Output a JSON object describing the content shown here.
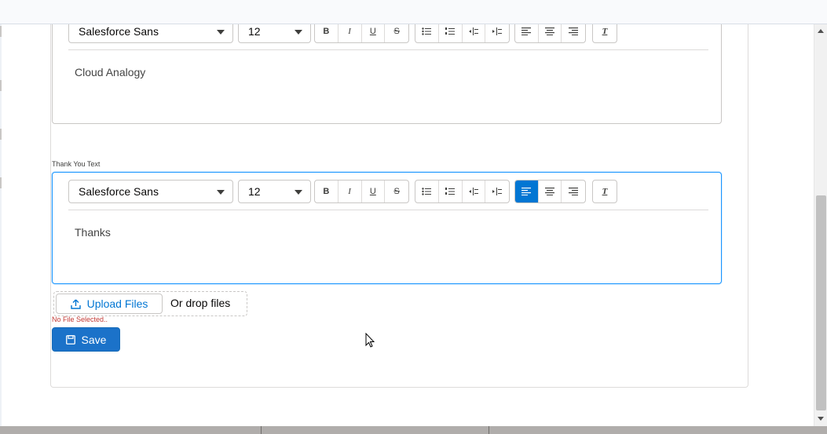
{
  "editors": [
    {
      "font_family": "Salesforce Sans",
      "font_size": "12",
      "content": "Cloud Analogy",
      "active_alignment": "none"
    },
    {
      "label": "Thank You Text",
      "font_family": "Salesforce Sans",
      "font_size": "12",
      "content": "Thanks",
      "active_alignment": "align-left"
    }
  ],
  "toolbar": {
    "bold": "B",
    "italic": "I",
    "underline": "U",
    "strike": "S",
    "clear_format": "T"
  },
  "upload": {
    "button_label": "Upload Files",
    "drop_text": "Or drop files",
    "status": "No File Selected.."
  },
  "save_label": "Save",
  "colors": {
    "brand": "#0176d3",
    "save_button": "#1b72c9",
    "focus_border": "#1b96ff",
    "error": "#c23934"
  }
}
